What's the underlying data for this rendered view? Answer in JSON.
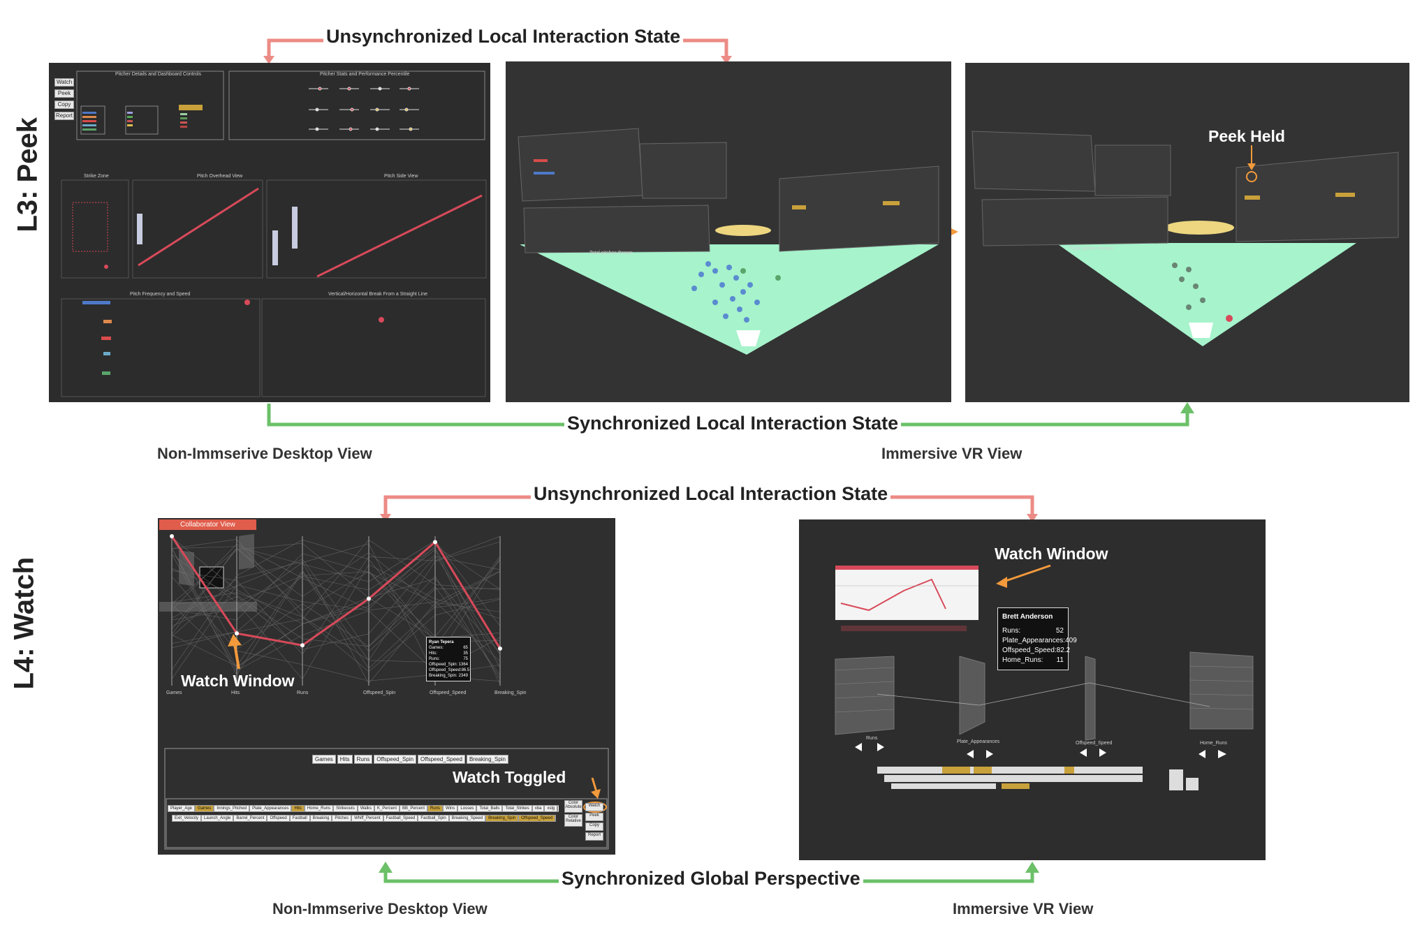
{
  "sections": {
    "peek": {
      "row_label": "L3: Peek",
      "top_arrow_label": "Unsynchronized Local Interaction State",
      "bottom_arrow_label": "Synchronized Local Interaction State",
      "caption_desktop": "Non-Immserive Desktop View",
      "caption_vr": "Immersive VR View",
      "desktop": {
        "header_left": "Pitcher Details and Dashboard Controls",
        "header_right": "Pitcher Stats and Performance Percentile",
        "buttons": [
          "Watch",
          "Peek",
          "Copy",
          "Report"
        ],
        "chart_strike_zone": "Strike Zone",
        "chart_overhead": "Pitch Overhead View",
        "chart_side": "Pitch Side View",
        "chart_freq": "Pitch Frequency and Speed",
        "chart_break": "Vertical/Horizontal Break From a Straight Line"
      },
      "vr_peek_annot": "Peek Held",
      "vr_total_label": "Total pitches thrown"
    },
    "watch": {
      "row_label": "L4: Watch",
      "top_arrow_label": "Unsynchronized Local Interaction State",
      "bottom_arrow_label": "Synchronized Global Perspective",
      "caption_desktop": "Non-Immserive Desktop View",
      "caption_vr": "Immersive VR View",
      "desktop": {
        "collab_tag": "Collaborator View",
        "watch_window_annot": "Watch Window",
        "watch_toggled_annot": "Watch Toggled",
        "axes": [
          "Games",
          "Hits",
          "Runs",
          "Offspeed_Spin",
          "Offspeed_Speed",
          "Breaking_Spin"
        ],
        "selected_axes": [
          "Games",
          "Hits",
          "Runs",
          "Offspeed_Spin",
          "Offspeed_Speed",
          "Breaking_Spin"
        ],
        "tooltip": {
          "name": "Ryan Tepera",
          "rows": [
            {
              "k": "Games:",
              "v": "65"
            },
            {
              "k": "Hits:",
              "v": "35"
            },
            {
              "k": "Runs:",
              "v": "75"
            },
            {
              "k": "Offspeed_Spin:",
              "v": "1364"
            },
            {
              "k": "Offspeed_Speed:",
              "v": "86.5"
            },
            {
              "k": "Breaking_Spin:",
              "v": "2349"
            }
          ]
        },
        "chips_row1": [
          "Player_Age",
          "Games",
          "Innings_Pitched",
          "Plate_Appearances",
          "Hits",
          "Home_Runs",
          "Strikeouts",
          "Walks",
          "K_Percent",
          "BB_Percent",
          "Runs",
          "Wins",
          "Losses",
          "Total_Balls",
          "Total_Strikes",
          "xba",
          "xslg",
          "woba",
          "xobp",
          "xiso"
        ],
        "chips_row2": [
          "Exit_Velocity",
          "Launch_Angle",
          "Barrel_Percent",
          "Offspeed",
          "Fastball",
          "Breaking",
          "Pitches",
          "Whiff_Percent",
          "Fastball_Speed",
          "Fastball_Spin",
          "Breaking_Speed",
          "Breaking_Spin",
          "Offspeed_Speed",
          "Offspeed_Spin"
        ],
        "chips_on": [
          "Games",
          "Hits",
          "Runs",
          "Breaking_Spin",
          "Offspeed_Speed",
          "Offspeed_Spin"
        ],
        "side_buttons": [
          "Color Absolute",
          "Color Relative"
        ],
        "action_buttons": [
          "Watch",
          "Peek",
          "Copy",
          "Report"
        ]
      },
      "vr": {
        "watch_window_annot": "Watch Window",
        "tooltip": {
          "name": "Brett Anderson",
          "rows": [
            {
              "k": "Runs:",
              "v": "52"
            },
            {
              "k": "Plate_Appearances:",
              "v": "409"
            },
            {
              "k": "Offspeed_Speed:",
              "v": "82.2"
            },
            {
              "k": "Home_Runs:",
              "v": "11"
            }
          ]
        },
        "axis_labels": [
          "Runs",
          "Plate_Appearances",
          "Offspeed_Speed",
          "Home_Runs"
        ]
      }
    }
  },
  "colors": {
    "unsync": "#ec8b85",
    "sync": "#6cc068",
    "accent": "#f39a3c",
    "panel_bg": "#2e2e2e",
    "highlight_line": "#d84a5a"
  },
  "chart_data": {
    "type": "line",
    "title": "",
    "categories": [
      "Games",
      "Hits",
      "Runs",
      "Offspeed_Spin",
      "Offspeed_Speed",
      "Breaking_Spin"
    ],
    "axis_ranges": {
      "Games": [
        10,
        45
      ],
      "Hits": [
        0,
        100
      ],
      "Runs": [
        0,
        100
      ],
      "Offspeed_Spin": [
        200,
        2200
      ],
      "Offspeed_Speed": [
        0,
        90
      ],
      "Breaking_Spin": [
        2200,
        2800
      ]
    },
    "series": [
      {
        "name": "Ryan Tepera",
        "values": [
          45,
          35,
          27,
          1364,
          86.5,
          2349
        ]
      }
    ],
    "xlabel": "",
    "ylabel": ""
  }
}
